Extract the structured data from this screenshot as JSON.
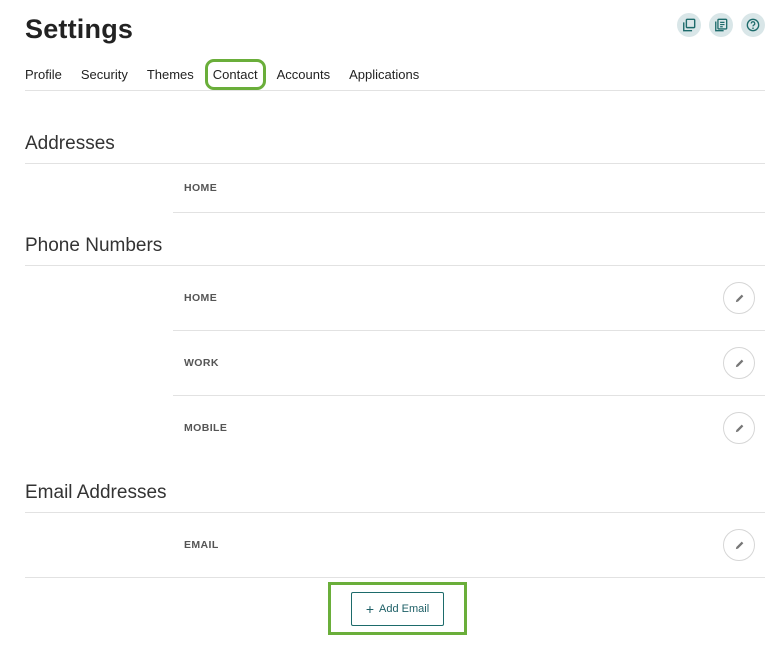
{
  "header": {
    "title": "Settings"
  },
  "top_icons": [
    {
      "name": "copy-icon"
    },
    {
      "name": "notes-icon"
    },
    {
      "name": "help-icon"
    }
  ],
  "tabs": [
    {
      "label": "Profile"
    },
    {
      "label": "Security"
    },
    {
      "label": "Themes"
    },
    {
      "label": "Contact",
      "active": true
    },
    {
      "label": "Accounts"
    },
    {
      "label": "Applications"
    }
  ],
  "addresses": {
    "title": "Addresses",
    "rows": [
      {
        "label": "HOME"
      }
    ]
  },
  "phones": {
    "title": "Phone Numbers",
    "rows": [
      {
        "label": "HOME"
      },
      {
        "label": "WORK"
      },
      {
        "label": "MOBILE"
      }
    ]
  },
  "emails": {
    "title": "Email Addresses",
    "rows": [
      {
        "label": "EMAIL"
      }
    ],
    "add_label": "Add Email"
  },
  "colors": {
    "accent": "#1d6b6b",
    "highlight": "#6aae3a",
    "icon_bg": "#d9e6e8"
  }
}
